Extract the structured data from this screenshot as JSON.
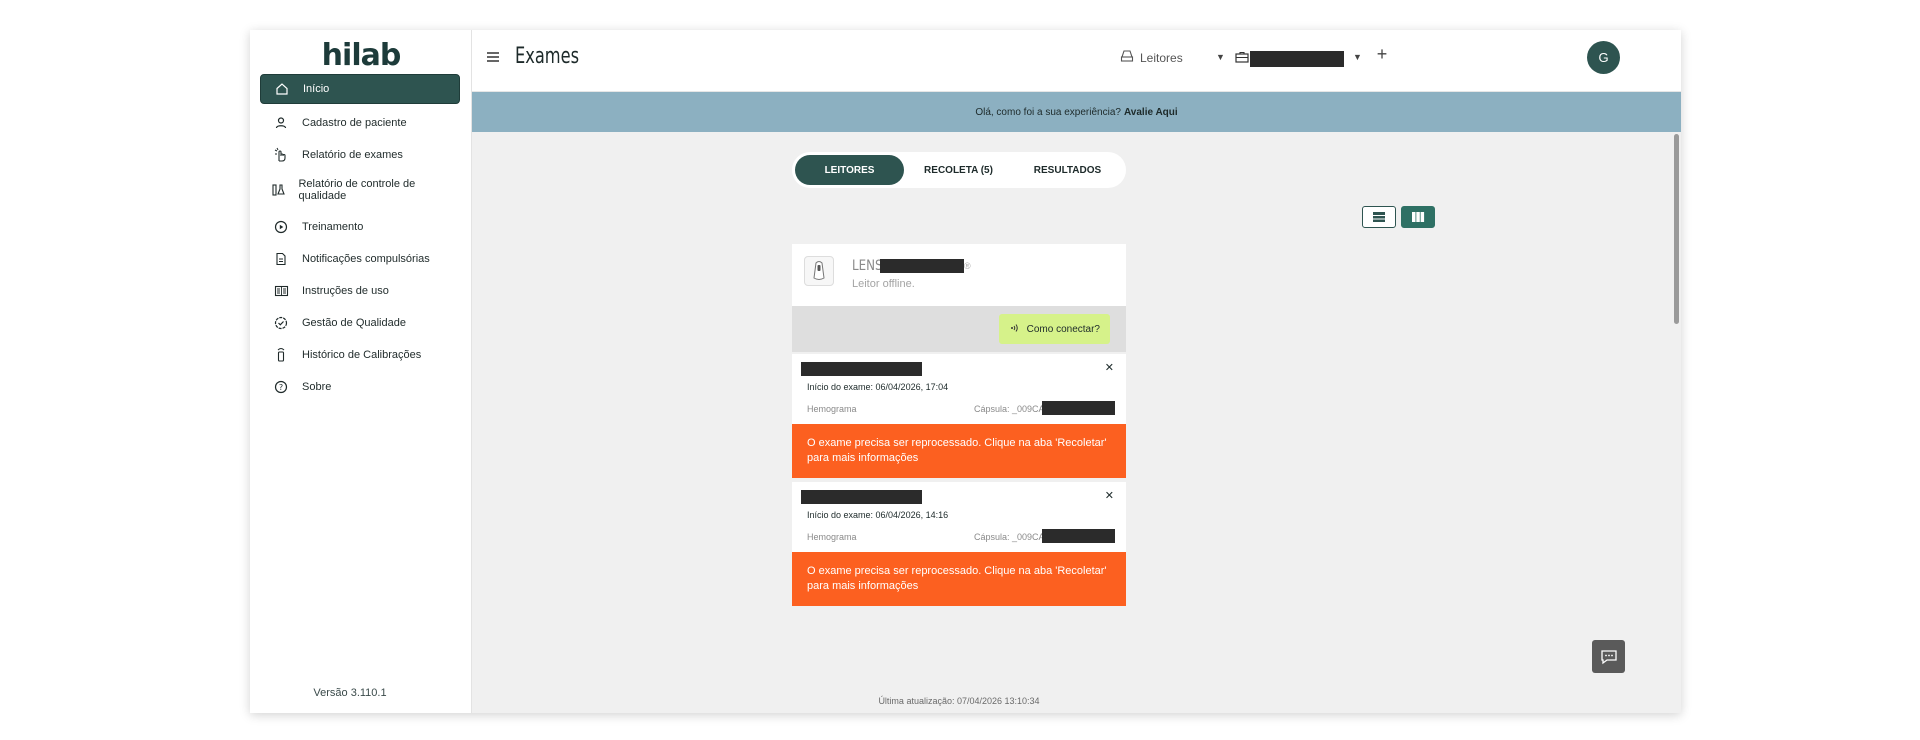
{
  "brand": {
    "logo_text": "hilab",
    "version": "Versão 3.110.1"
  },
  "sidebar": {
    "items": [
      {
        "label": "Início",
        "icon": "home-icon",
        "active": true
      },
      {
        "label": "Cadastro de paciente",
        "icon": "user-icon"
      },
      {
        "label": "Relatório de exames",
        "icon": "hand-pointer-icon"
      },
      {
        "label": "Relatório de controle de qualidade",
        "icon": "flask-chart-icon"
      },
      {
        "label": "Treinamento",
        "icon": "play-circle-icon"
      },
      {
        "label": "Notificações compulsórias",
        "icon": "document-icon"
      },
      {
        "label": "Instruções de uso",
        "icon": "book-icon"
      },
      {
        "label": "Gestão de Qualidade",
        "icon": "check-badge-icon"
      },
      {
        "label": "Histórico de Calibrações",
        "icon": "device-tube-icon"
      },
      {
        "label": "Sobre",
        "icon": "help-circle-icon"
      }
    ]
  },
  "header": {
    "title": "Exames",
    "readers_label": "Leitores",
    "plus_label": "+",
    "avatar_initial": "G"
  },
  "feedback": {
    "text": "Olá, como foi a sua experiência?",
    "link": "Avalie Aqui"
  },
  "tabs": [
    {
      "label": "LEITORES",
      "active": true
    },
    {
      "label": "RECOLETA (5)",
      "active": false
    },
    {
      "label": "RESULTADOS",
      "active": false
    }
  ],
  "reader": {
    "name_prefix": "LENS-",
    "status": "Leitor offline.",
    "connect_label": "Como conectar?"
  },
  "exams": [
    {
      "start": "Início do exame: 06/04/2026, 17:04",
      "type": "Hemograma",
      "capsule": "Cápsula: _009CA",
      "warning": "O exame precisa ser reprocessado. Clique na aba 'Recoletar' para mais informações"
    },
    {
      "start": "Início do exame: 06/04/2026, 14:16",
      "type": "Hemograma",
      "capsule": "Cápsula: _009CA",
      "warning": "O exame precisa ser reprocessado. Clique na aba 'Recoletar' para mais informações"
    }
  ],
  "footer": {
    "last_update": "Última atualização: 07/04/2026 13:10:34"
  },
  "colors": {
    "primary": "#2e5450",
    "accent_green": "#d6f28a",
    "warning": "#fc6020",
    "feedback_bar": "#8cb0c1"
  }
}
